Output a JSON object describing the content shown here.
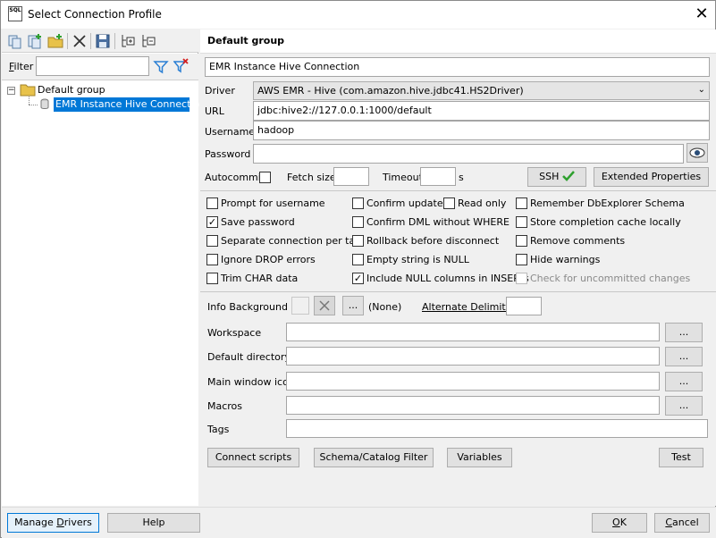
{
  "window": {
    "title": "Select Connection Profile",
    "app_icon_text": "SQL"
  },
  "left": {
    "filter_label": "Filter",
    "filter_value": "",
    "tree": {
      "group": "Default group",
      "item": "EMR Instance Hive Connection"
    }
  },
  "right": {
    "group_header": "Default group",
    "profile_name": "EMR Instance Hive Connection",
    "driver_label": "Driver",
    "driver_value": "AWS EMR - Hive (com.amazon.hive.jdbc41.HS2Driver)",
    "url_label": "URL",
    "url_value": "jdbc:hive2://127.0.0.1:1000/default",
    "username_label": "Username",
    "username_value": "hadoop",
    "password_label": "Password",
    "password_value": "",
    "autocommit_label": "Autocommit",
    "fetch_size_label": "Fetch size",
    "timeout_label": "Timeout",
    "timeout_unit": "s",
    "ssh_label": "SSH",
    "ext_props_label": "Extended Properties",
    "options": {
      "prompt_username": "Prompt for username",
      "save_password": "Save password",
      "separate_conn": "Separate connection per tab",
      "ignore_drop": "Ignore DROP errors",
      "trim_char": "Trim CHAR data",
      "confirm_updates": "Confirm updates",
      "read_only": "Read only",
      "confirm_dml": "Confirm DML without WHERE",
      "rollback": "Rollback before disconnect",
      "empty_null": "Empty string is NULL",
      "include_null": "Include NULL columns in INSERTs",
      "remember_schema": "Remember DbExplorer Schema",
      "store_cache": "Store completion cache locally",
      "remove_comments": "Remove comments",
      "hide_warnings": "Hide warnings",
      "check_uncommitted": "Check for uncommitted changes"
    },
    "info_bg_label": "Info Background",
    "info_bg_value": "(None)",
    "alt_delim_label": "Alternate Delimiter",
    "ellipsis": "...",
    "workspace_label": "Workspace",
    "default_dir_label": "Default directory",
    "main_icon_label": "Main window icon",
    "macros_label": "Macros",
    "tags_label": "Tags",
    "connect_scripts": "Connect scripts",
    "schema_filter": "Schema/Catalog Filter",
    "variables": "Variables",
    "test": "Test"
  },
  "bottom": {
    "manage_drivers": "Manage Drivers",
    "help": "Help",
    "ok": "OK",
    "cancel": "Cancel"
  },
  "colors": {
    "selection": "#0078d7",
    "ssh_check": "#2ea02e",
    "filter_icon": "#2a7fd4",
    "folder": "#e8c24a"
  }
}
